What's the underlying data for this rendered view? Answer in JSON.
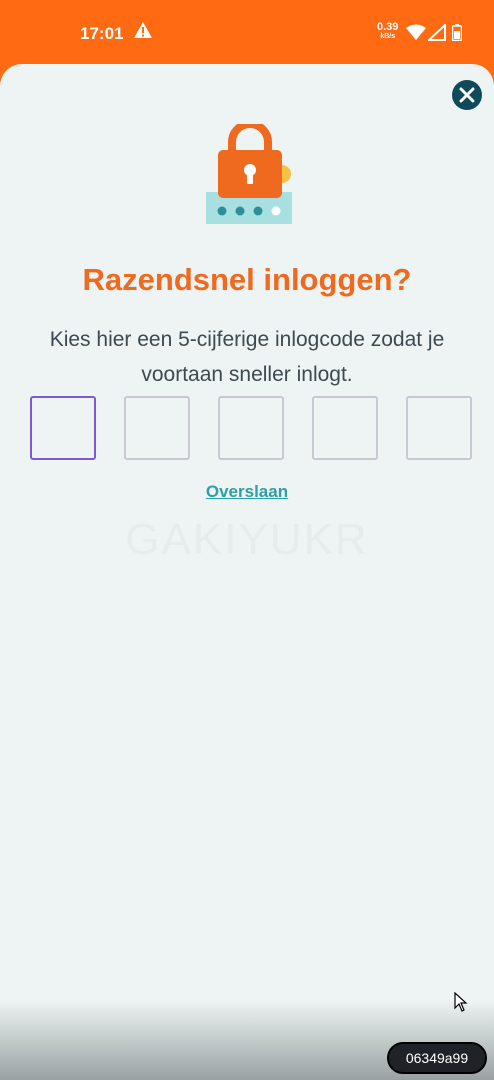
{
  "status_bar": {
    "time": "17:01",
    "net_speed": "0.39",
    "net_unit": "kB/s",
    "icons": [
      "warning-icon",
      "wifi-icon",
      "signal-icon",
      "battery-icon"
    ]
  },
  "dialog": {
    "title": "Razendsnel inloggen?",
    "description": "Kies hier een 5-cijferige inlogcode zodat je voortaan sneller inlogt.",
    "code_boxes": [
      "",
      "",
      "",
      "",
      ""
    ],
    "skip_label": "Overslaan",
    "watermark": "GAKIYUKR",
    "close_icon": "close-icon",
    "illustration": "padlock-icon"
  },
  "session_badge": "06349a99",
  "colors": {
    "brand_orange": "#ff6a13",
    "title_orange": "#ef6a1f",
    "sheet_bg": "#edf4f3",
    "close_bg": "#0f4a5c",
    "link_teal": "#2e9fa6",
    "active_border": "#7d5ad1"
  }
}
